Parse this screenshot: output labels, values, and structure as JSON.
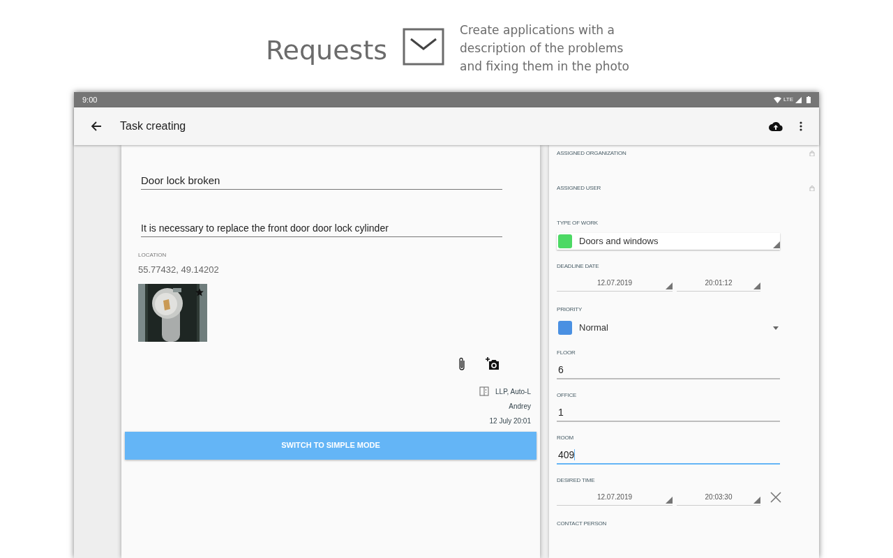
{
  "header": {
    "title": "Requests",
    "description": "Create applications with a description of the problems and fixing them in the photo"
  },
  "status_bar": {
    "time": "9:00",
    "network": "LTE"
  },
  "toolbar": {
    "title": "Task creating"
  },
  "task": {
    "title_value": "Door lock broken",
    "description_value": "It is necessary to replace the front door door lock cylinder",
    "location": {
      "label": "LOCATION",
      "value": "55.77432, 49.14202"
    },
    "meta": {
      "organization": "LLP, Auto-L",
      "user": "Andrey",
      "date": "12 July 20:01"
    },
    "switch_button": "SWITCH TO SIMPLE MODE"
  },
  "fields": [
    {
      "kind": "locked",
      "label": "ASSIGNED ORGANIZATION"
    },
    {
      "kind": "locked",
      "label": "ASSIGNED USER"
    },
    {
      "kind": "select",
      "label": "TYPE OF WORK",
      "value": "Doors and windows",
      "color": "#4cd964",
      "boxed": true
    },
    {
      "kind": "datetime",
      "label": "DEADLINE DATE",
      "date": "12.07.2019",
      "time": "20:01:12",
      "clearable": false
    },
    {
      "kind": "select",
      "label": "PRIORITY",
      "value": "Normal",
      "color": "#4a90e2",
      "boxed": false
    },
    {
      "kind": "text",
      "label": "FLOOR",
      "value": "6",
      "focused": false
    },
    {
      "kind": "text",
      "label": "OFFICE",
      "value": "1",
      "focused": false
    },
    {
      "kind": "text",
      "label": "ROOM",
      "value": "409",
      "focused": true
    },
    {
      "kind": "datetime",
      "label": "DESIRED TIME",
      "date": "12.07.2019",
      "time": "20:03:30",
      "clearable": true
    },
    {
      "kind": "empty",
      "label": "CONTACT PERSON"
    }
  ]
}
